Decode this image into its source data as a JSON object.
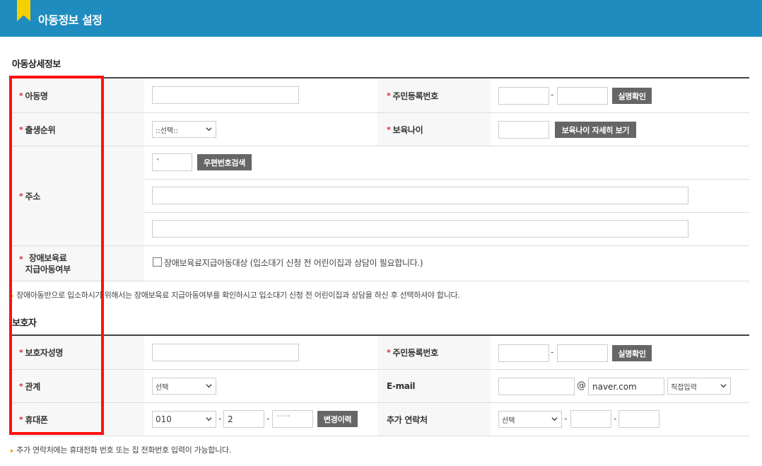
{
  "header": {
    "title": "아동정보 설정"
  },
  "child_section": {
    "title": "아동상세정보",
    "name_label": "아동명",
    "rrn_label": "주민등록번호",
    "verify_btn": "실명확인",
    "birth_order_label": "출생순위",
    "birth_order_value": "::선택::",
    "care_age_label": "보육나이",
    "care_age_btn": "보육나이 자세히 보기",
    "address_label": "주소",
    "zip_value": "`",
    "zip_btn": "우편번호검색",
    "disability_label_1": "장애보육료",
    "disability_label_2": "지급아동여부",
    "disability_check_label": "장애보육료지급아동대상 (입소대기 신청 전 어린이집과 상담이 필요합니다.)",
    "note": "장애아동반으로 입소하시기 위해서는 장애보육료 지급아동여부를 확인하시고 입소대기 신청 전 어린이집과 상담을 하신 후 선택하셔야 합니다."
  },
  "guardian_section": {
    "title": "보호자",
    "name_label": "보호자성명",
    "rrn_label": "주민등록번호",
    "verify_btn": "실명확인",
    "relation_label": "관계",
    "relation_value": "선택",
    "email_label": "E-mail",
    "email_at": "@",
    "email_domain": "naver.com",
    "email_select": "직접입력",
    "phone_label": "휴대폰",
    "phone_prefix": "010",
    "phone_mid": "2",
    "phone_last": "˜˜˜˜",
    "history_btn": "변경이력",
    "extra_contact_label": "추가 연락처",
    "extra_select": "선택",
    "note": "추가 연락처에는 휴대전화 번호 또는 집 전화번호 입력이 가능합니다."
  },
  "symbols": {
    "dash": "-",
    "required": "*"
  },
  "colors": {
    "header": "#1f8cbf",
    "ribbon": "#f5d000",
    "required": "#d9272e",
    "highlight": "#ff1010",
    "button": "#666666"
  }
}
